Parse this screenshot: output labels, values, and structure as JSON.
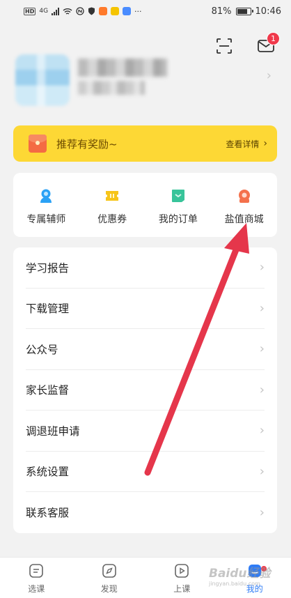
{
  "status_bar": {
    "hd": "HD",
    "signal": "4G",
    "battery": "81%",
    "time": "10:46",
    "more": "···"
  },
  "header": {
    "message_badge": "1"
  },
  "reward": {
    "title": "推荐有奖励~",
    "link": "查看详情"
  },
  "quick_entries": [
    {
      "label": "专属辅师",
      "icon": "tutor-icon",
      "color": "#2aa1f5"
    },
    {
      "label": "优惠券",
      "icon": "coupon-icon",
      "color": "#f7c51a"
    },
    {
      "label": "我的订单",
      "icon": "order-icon",
      "color": "#38c49a"
    },
    {
      "label": "盐值商城",
      "icon": "mall-icon",
      "color": "#f4714c"
    }
  ],
  "menu": [
    {
      "label": "学习报告"
    },
    {
      "label": "下载管理"
    },
    {
      "label": "公众号"
    },
    {
      "label": "家长监督"
    },
    {
      "label": "调退班申请"
    },
    {
      "label": "系统设置"
    },
    {
      "label": "联系客服"
    }
  ],
  "tabs": [
    {
      "label": "选课",
      "icon": "course-select-icon"
    },
    {
      "label": "发现",
      "icon": "discover-icon"
    },
    {
      "label": "上课",
      "icon": "class-icon"
    },
    {
      "label": "我的",
      "icon": "profile-icon",
      "active": true
    }
  ],
  "watermark": {
    "brand": "Baidu经验",
    "url": "jingyan.baidu.com"
  },
  "colors": {
    "accent": "#2f7cf6",
    "banner": "#fdd835",
    "badge": "#f0394b",
    "arrow": "#e5364b"
  }
}
